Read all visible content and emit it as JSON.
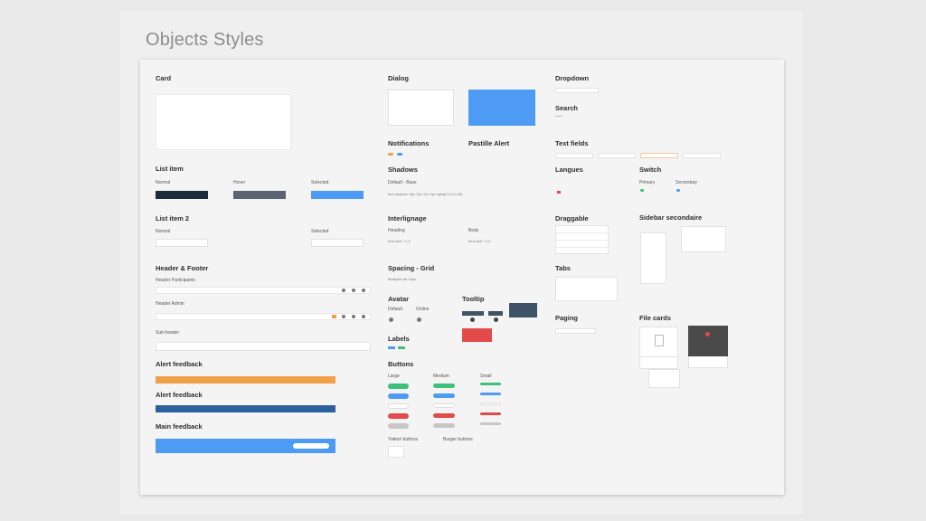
{
  "page": {
    "title": "Objects Styles"
  },
  "card": {
    "title": "Card"
  },
  "list_item": {
    "title": "List item",
    "normal": "Normal",
    "hover": "Hover",
    "selected": "Selected"
  },
  "list_item_2": {
    "title": "List item 2",
    "normal": "Normal",
    "selected": "Selected"
  },
  "header_footer": {
    "title": "Header & Footer",
    "participants": "Header Participants",
    "admin": "Header Admin",
    "subheader": "Sub-header"
  },
  "alerts": {
    "alert1_title": "Alert feedback",
    "alert2_title": "Alert feedback",
    "main_title": "Main feedback"
  },
  "dialog": {
    "title": "Dialog"
  },
  "notifications": {
    "title": "Notifications"
  },
  "pastille": {
    "title": "Pastille Alert"
  },
  "shadows": {
    "title": "Shadows",
    "default": "Default - Base",
    "spec": "box-shadow: 0px 3px 7px 0px rgba(0,0,0,0.20)"
  },
  "interlignage": {
    "title": "Interlignage",
    "heading": "Heading",
    "heading_spec": "font-size * 1.3",
    "body": "Body",
    "body_spec": "font-size * 1.5"
  },
  "spacing": {
    "title": "Spacing - Grid",
    "spec": "Multiples de 10px"
  },
  "avatar": {
    "title": "Avatar",
    "default": "Default",
    "online": "Online"
  },
  "tooltip": {
    "title": "Tooltip"
  },
  "labels": {
    "title": "Labels"
  },
  "buttons": {
    "title": "Buttons",
    "large": "Large",
    "medium": "Medium",
    "small": "Small",
    "yaktori": "Yaktori buttons",
    "burger": "Burger buttons"
  },
  "dropdown": {
    "title": "Dropdown"
  },
  "search": {
    "title": "Search"
  },
  "text_fields": {
    "title": "Text fields"
  },
  "langues": {
    "title": "Langues"
  },
  "switch": {
    "title": "Switch",
    "primary": "Primary",
    "secondary": "Secondary"
  },
  "draggable": {
    "title": "Draggable"
  },
  "sidebar_secondaire": {
    "title": "Sidebar secondaire"
  },
  "tabs": {
    "title": "Tabs"
  },
  "paging": {
    "title": "Paging"
  },
  "file_cards": {
    "title": "File cards"
  },
  "colors": {
    "navy": "#1c2a3a",
    "slate": "#5b6472",
    "blue": "#4d9bf3",
    "orange": "#f0a047",
    "darkblue": "#2e5f9e",
    "green": "#3cc17a",
    "red": "#e34a4a",
    "gray": "#c7c7c7",
    "tooltip": "#3e5366",
    "filecard_dark": "#4a4a4a"
  }
}
